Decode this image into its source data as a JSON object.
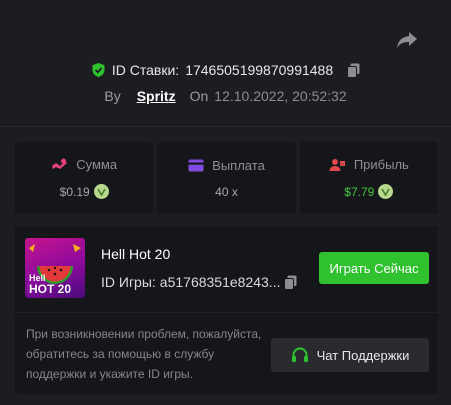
{
  "bet": {
    "id_label": "ID Ставки:",
    "id_value": "1746505199870991488"
  },
  "author": {
    "by_label": "By",
    "username": "Spritz",
    "on_label": "On",
    "date": "12.10.2022, 20:52:32"
  },
  "stats": [
    {
      "label": "Сумма",
      "value": "$0.19",
      "has_coin": true
    },
    {
      "label": "Выплата",
      "value": "40 x",
      "has_coin": false
    },
    {
      "label": "Прибыль",
      "value": "$7.79",
      "has_coin": true
    }
  ],
  "game": {
    "thumb_line1": "Hell",
    "thumb_line2": "HOT 20",
    "title": "Hell Hot 20",
    "id_label": "ID Игры:",
    "id_value": "a51768351e8243...",
    "play_label": "Играть Сейчас"
  },
  "support": {
    "help_text": "При возникновении проблем, пожалуйста, обратитесь за помощью в службу поддержки и укажите ID игры.",
    "button_label": "Чат Поддержки"
  },
  "colors": {
    "background": "#1c1d20",
    "card": "#151619",
    "accent_green": "#2fc22e",
    "profit_green": "#3fc538",
    "stake_pink": "#e8407a",
    "payout_purple": "#7f4be0",
    "profit_red": "#e2474d"
  },
  "icons": [
    "share-icon",
    "verified-shield-icon",
    "copy-icon",
    "stake-icon",
    "payout-card-icon",
    "profit-icon",
    "coin-icon",
    "headset-icon"
  ]
}
